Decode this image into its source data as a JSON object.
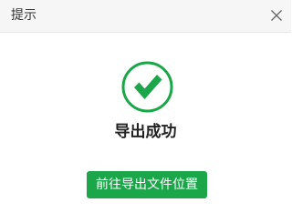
{
  "dialog": {
    "title": "提示",
    "close_icon": "close-icon",
    "status_icon": "check-circle-icon",
    "message": "导出成功",
    "action_label": "前往导出文件位置"
  },
  "colors": {
    "accent": "#1ba64a",
    "titlebar_bg": "#f6f6f6",
    "text": "#222222"
  }
}
